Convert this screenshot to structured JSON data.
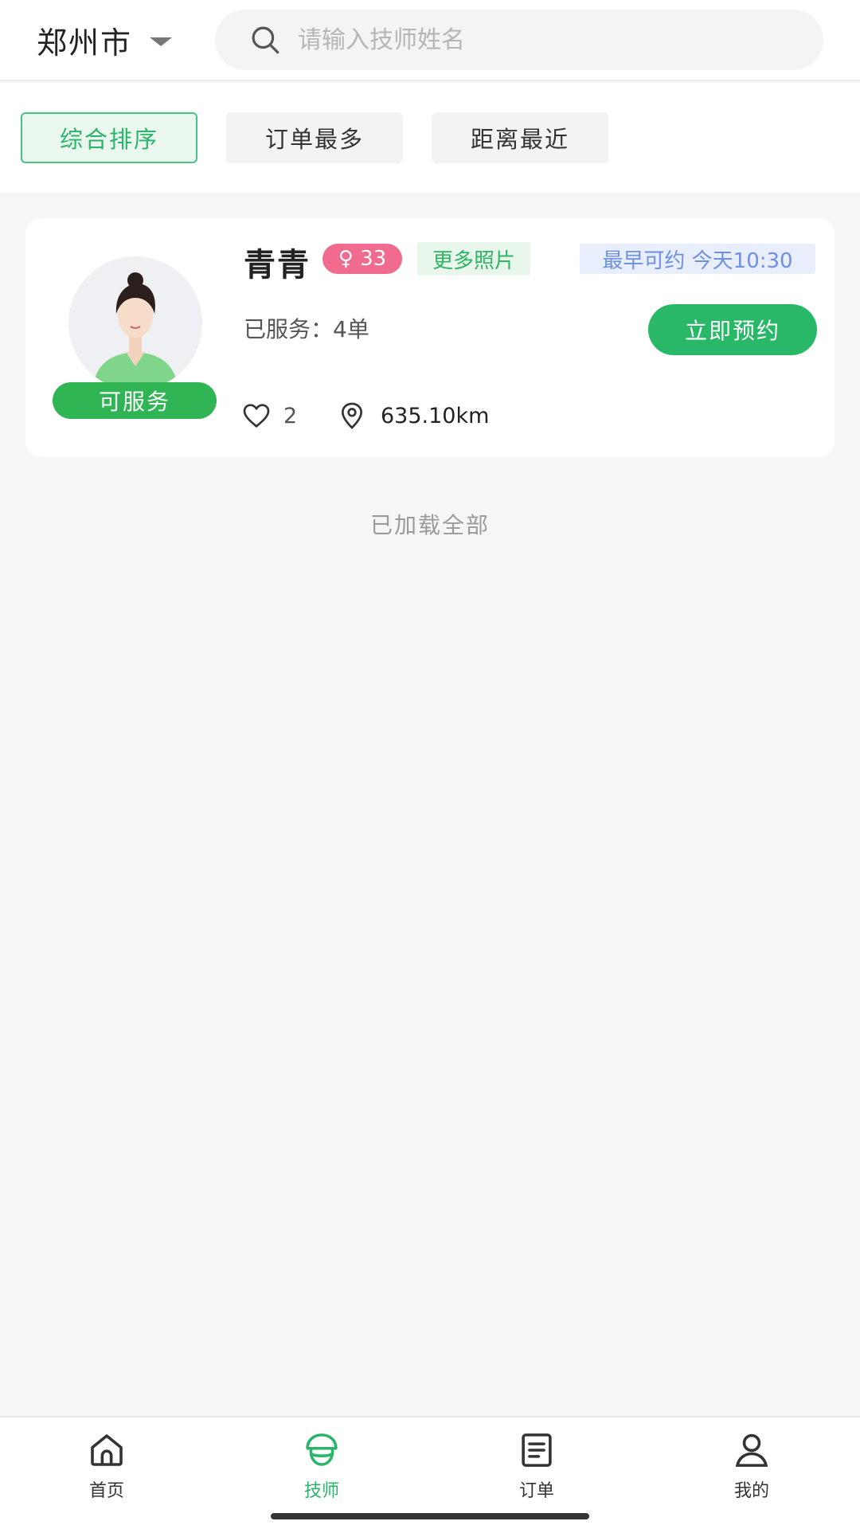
{
  "header": {
    "city": "郑州市",
    "search_placeholder": "请输入技师姓名"
  },
  "filters": [
    {
      "label": "综合排序",
      "active": true
    },
    {
      "label": "订单最多",
      "active": false
    },
    {
      "label": "距离最近",
      "active": false
    }
  ],
  "technicians": [
    {
      "name": "青青",
      "gender_age": "♀ 33",
      "more_photos": "更多照片",
      "earliest": "最早可约 今天10:30",
      "served": "已服务：4单",
      "book_label": "立即预约",
      "status": "可服务",
      "likes": "2",
      "distance": "635.10km"
    }
  ],
  "list_footer": "已加载全部",
  "tabbar": {
    "items": [
      {
        "label": "首页",
        "icon": "home-icon"
      },
      {
        "label": "技师",
        "icon": "technician-icon",
        "active": true
      },
      {
        "label": "订单",
        "icon": "orders-icon"
      },
      {
        "label": "我的",
        "icon": "profile-icon"
      }
    ]
  },
  "colors": {
    "accent": "#2bb56a",
    "status_green": "#2fb553",
    "pink_badge": "#f06b8d",
    "blue_tag": "#6f8fe0"
  }
}
